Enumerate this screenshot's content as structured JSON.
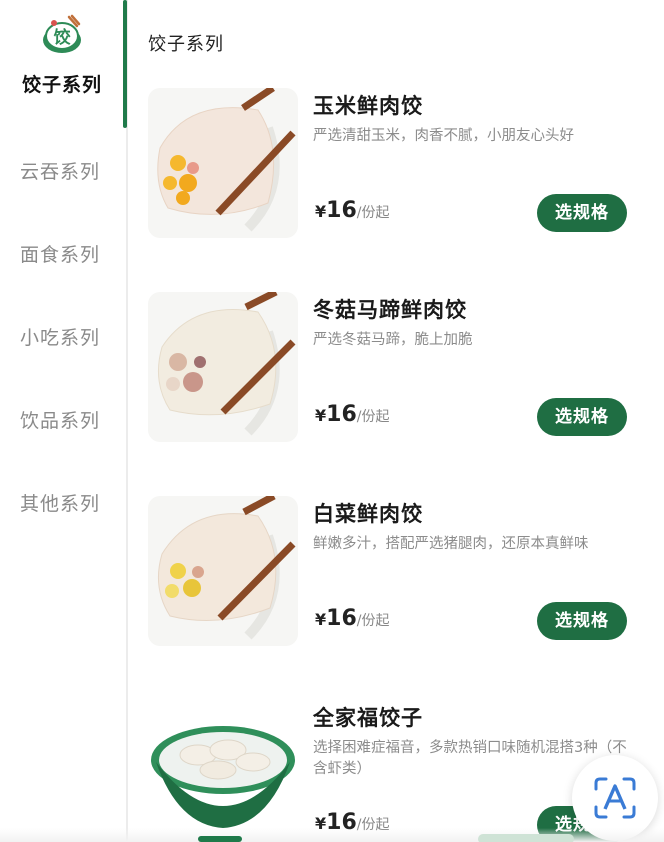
{
  "colors": {
    "accent": "#1f6e43",
    "active_bar": "#1f7a4a"
  },
  "sidebar": {
    "active": {
      "label": "饺子系列",
      "icon": "dumpling-logo-icon"
    },
    "items": [
      {
        "label": "云吞系列"
      },
      {
        "label": "面食系列"
      },
      {
        "label": "小吃系列"
      },
      {
        "label": "饮品系列"
      },
      {
        "label": "其他系列"
      }
    ]
  },
  "main": {
    "section_title": "饺子系列",
    "products": [
      {
        "name": "玉米鲜肉饺",
        "desc": "严选清甜玉米，肉香不腻，小朋友心头好",
        "price_symbol": "¥",
        "price": "16",
        "unit": "/份起",
        "button": "选规格"
      },
      {
        "name": "冬菇马蹄鲜肉饺",
        "desc": "严选冬菇马蹄，脆上加脆",
        "price_symbol": "¥",
        "price": "16",
        "unit": "/份起",
        "button": "选规格"
      },
      {
        "name": "白菜鲜肉饺",
        "desc": "鲜嫩多汁，搭配严选猪腿肉，还原本真鲜味",
        "price_symbol": "¥",
        "price": "16",
        "unit": "/份起",
        "button": "选规格"
      },
      {
        "name": "全家福饺子",
        "desc": "选择困难症福音，多款热销口味随机混搭3种（不含虾类）",
        "price_symbol": "¥",
        "price": "16",
        "unit": "/份起",
        "button": "选规格"
      }
    ]
  },
  "float_button": {
    "icon": "translate-scan-icon"
  }
}
